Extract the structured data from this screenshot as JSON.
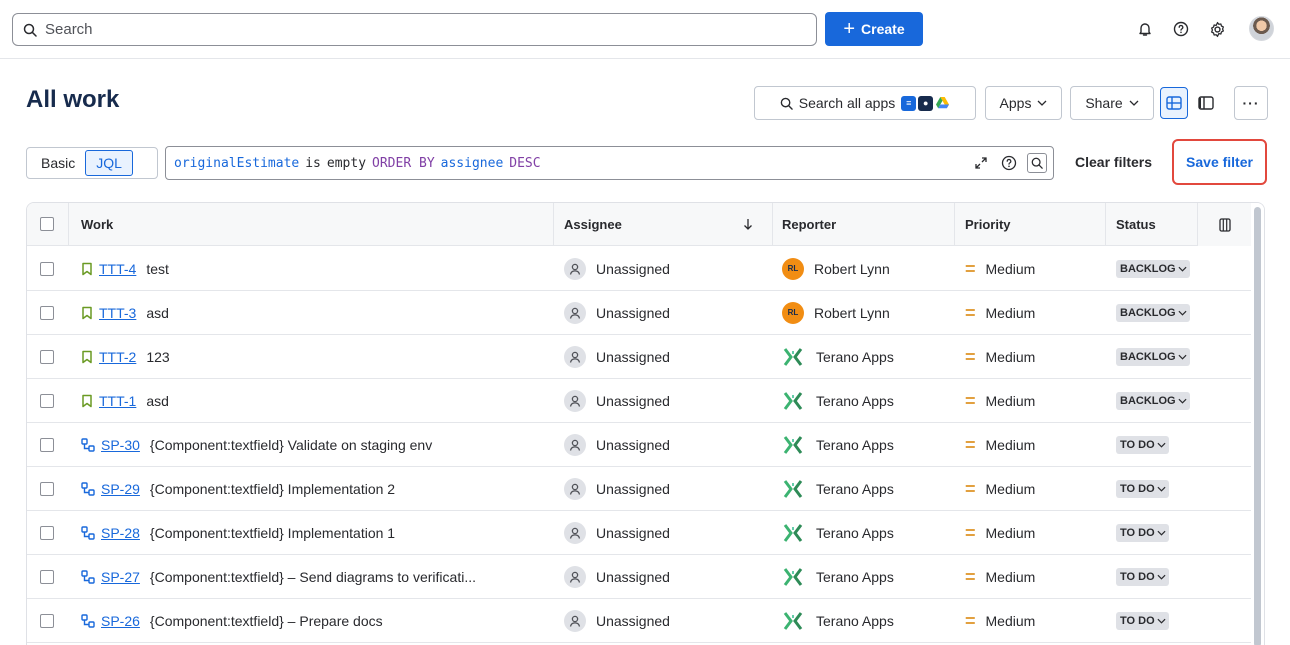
{
  "topbar": {
    "search_placeholder": "Search",
    "create_label": "Create"
  },
  "header": {
    "title": "All work",
    "search_apps_label": "Search all apps",
    "apps_label": "Apps",
    "share_label": "Share",
    "more_label": "···"
  },
  "filter": {
    "basic_label": "Basic",
    "jql_label": "JQL",
    "jql_field": "originalEstimate",
    "jql_op": "is",
    "jql_val": "empty",
    "jql_kw": "ORDER BY",
    "jql_sort": "assignee",
    "jql_dir": "DESC",
    "clear_label": "Clear filters",
    "save_label": "Save filter"
  },
  "table": {
    "headers": {
      "work": "Work",
      "assignee": "Assignee",
      "reporter": "Reporter",
      "priority": "Priority",
      "status": "Status"
    },
    "rows": [
      {
        "key": "TTT-4",
        "type": "story",
        "summary": "test",
        "assignee": "Unassigned",
        "reporter": "Robert Lynn",
        "reporter_type": "rl",
        "reporter_initials": "RL",
        "priority": "Medium",
        "status": "BACKLOG"
      },
      {
        "key": "TTT-3",
        "type": "story",
        "summary": "asd",
        "assignee": "Unassigned",
        "reporter": "Robert Lynn",
        "reporter_type": "rl",
        "reporter_initials": "RL",
        "priority": "Medium",
        "status": "BACKLOG"
      },
      {
        "key": "TTT-2",
        "type": "story",
        "summary": "123",
        "assignee": "Unassigned",
        "reporter": "Terano Apps",
        "reporter_type": "terano",
        "reporter_initials": "",
        "priority": "Medium",
        "status": "BACKLOG"
      },
      {
        "key": "TTT-1",
        "type": "story",
        "summary": "asd",
        "assignee": "Unassigned",
        "reporter": "Terano Apps",
        "reporter_type": "terano",
        "reporter_initials": "",
        "priority": "Medium",
        "status": "BACKLOG"
      },
      {
        "key": "SP-30",
        "type": "subtask",
        "summary": "{Component:textfield} Validate on staging env",
        "assignee": "Unassigned",
        "reporter": "Terano Apps",
        "reporter_type": "terano",
        "reporter_initials": "",
        "priority": "Medium",
        "status": "TO DO"
      },
      {
        "key": "SP-29",
        "type": "subtask",
        "summary": "{Component:textfield} Implementation 2",
        "assignee": "Unassigned",
        "reporter": "Terano Apps",
        "reporter_type": "terano",
        "reporter_initials": "",
        "priority": "Medium",
        "status": "TO DO"
      },
      {
        "key": "SP-28",
        "type": "subtask",
        "summary": "{Component:textfield} Implementation 1",
        "assignee": "Unassigned",
        "reporter": "Terano Apps",
        "reporter_type": "terano",
        "reporter_initials": "",
        "priority": "Medium",
        "status": "TO DO"
      },
      {
        "key": "SP-27",
        "type": "subtask",
        "summary": "{Component:textfield} – Send diagrams to verificati...",
        "assignee": "Unassigned",
        "reporter": "Terano Apps",
        "reporter_type": "terano",
        "reporter_initials": "",
        "priority": "Medium",
        "status": "TO DO"
      },
      {
        "key": "SP-26",
        "type": "subtask",
        "summary": "{Component:textfield} – Prepare docs",
        "assignee": "Unassigned",
        "reporter": "Terano Apps",
        "reporter_type": "terano",
        "reporter_initials": "",
        "priority": "Medium",
        "status": "TO DO"
      }
    ]
  },
  "colors": {
    "accent": "#1868db",
    "story_icon": "#6a9a23",
    "subtask_icon": "#1868db",
    "priority_medium": "#e2a03f",
    "save_highlight": "#e2483d"
  }
}
